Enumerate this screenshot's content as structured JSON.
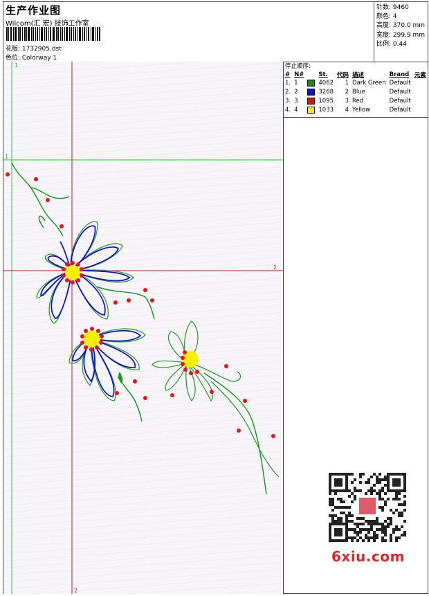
{
  "header": {
    "title": "生产作业图",
    "company": "Wilcom(汇 宏) 技饰工作室",
    "design": "花版: 1732905.dst",
    "colorway": "色位: Colorway 1"
  },
  "stats": {
    "stitches": "针数: 9460",
    "colors": "颜色: 4",
    "height": "高度: 370.0 mm",
    "width": "宽度: 299.9 mm",
    "scale": "比例: 0.44"
  },
  "stop_sequence": {
    "title": "停止顺序:",
    "columns": [
      "#",
      "N#",
      "St.",
      "代码",
      "描述",
      "Brand",
      "元素"
    ],
    "rows": [
      {
        "idx": "1.",
        "n": "1",
        "color": "#1a8a1a",
        "st": "4062",
        "code": "1",
        "desc": "Dark Green",
        "brand": "Default"
      },
      {
        "idx": "2.",
        "n": "2",
        "color": "#1010d0",
        "st": "3268",
        "code": "2",
        "desc": "Blue",
        "brand": "Default"
      },
      {
        "idx": "3.",
        "n": "3",
        "color": "#e01010",
        "st": "1095",
        "code": "3",
        "desc": "Red",
        "brand": "Default"
      },
      {
        "idx": "4.",
        "n": "4",
        "color": "#f0f000",
        "st": "1033",
        "code": "4",
        "desc": "Yellow",
        "brand": "Default"
      }
    ]
  },
  "guides": {
    "v1": "1",
    "h1": "1",
    "h2": "2",
    "v2": "2"
  },
  "watermark": {
    "logo": "6xiu.com"
  }
}
